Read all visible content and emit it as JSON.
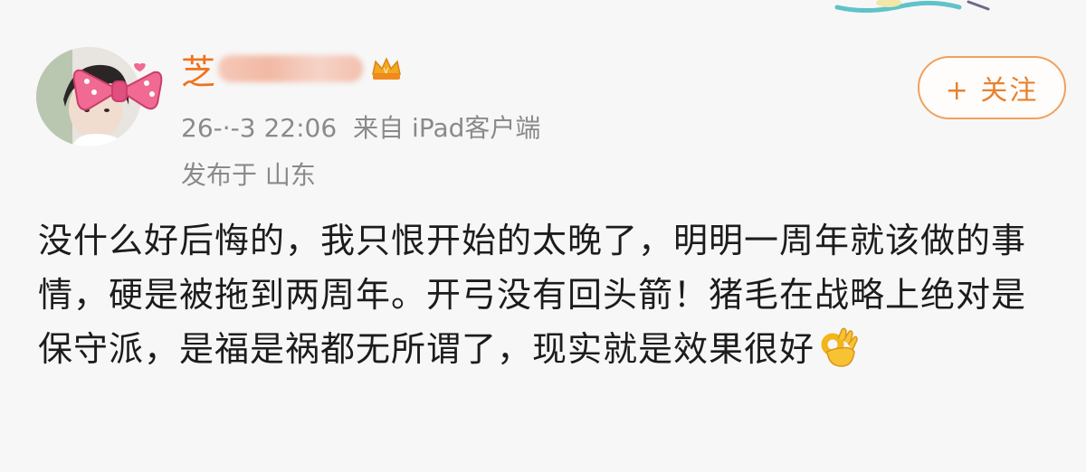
{
  "post": {
    "username_visible": "芝",
    "timestamp": "26-·-3 22:06",
    "source": "来自 iPad客户端",
    "location": "发布于 山东",
    "follow_label": "+ 关注",
    "body_text": "没什么好后悔的，我只恨开始的太晚了，明明一周年就该做的事情，硬是被拖到两周年。开弓没有回头箭！猪毛在战略上绝对是保守派，是福是祸都无所谓了，现实就是效果很好"
  },
  "icons": {
    "avatar": "avatar-photo",
    "bow": "pink-bow-icon",
    "vip": "crown-badge-icon",
    "emoji": "ok-hand-emoji"
  },
  "colors": {
    "username": "#f0721e",
    "meta": "#8a8a8a",
    "follow": "#e8812e",
    "follow_border": "#f0a15a",
    "body": "#1c1c1c"
  }
}
